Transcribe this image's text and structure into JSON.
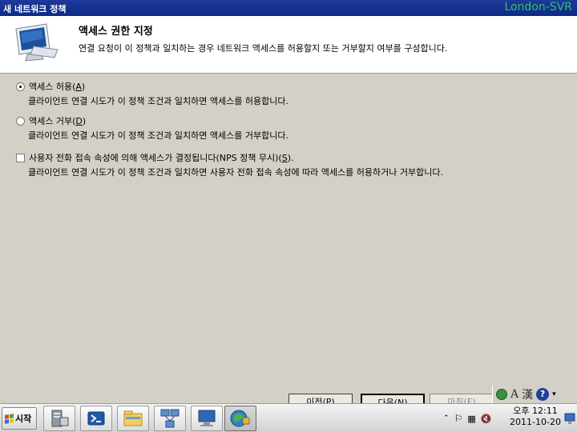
{
  "window": {
    "title": "새 네트워크 정책",
    "server_label": "London-SVR"
  },
  "header": {
    "title": "액세스 권한 지정",
    "description": "연결 요청이 이 정책과 일치하는 경우 네트워크 액세스를 허용할지 또는 거부할지 여부를 구성합니다."
  },
  "options": {
    "grant": {
      "label_before": "액세스 허용(",
      "hotkey": "A",
      "label_after": ")",
      "description": "클라이언트 연결 시도가 이 정책 조건과 일치하면 액세스를 허용합니다.",
      "selected": true
    },
    "deny": {
      "label_before": "액세스 거부(",
      "hotkey": "D",
      "label_after": ")",
      "description": "클라이언트 연결 시도가 이 정책 조건과 일치하면 액세스를 거부합니다.",
      "selected": false
    },
    "dialin": {
      "label_before": "사용자 전화 접속 속성에 의해 액세스가 결정됩니다(NPS 정책 무시)(",
      "hotkey": "S",
      "label_after": ").",
      "description": "클라이언트 연결 시도가 이 정책 조건과 일치하면 사용자 전화 접속 속성에 따라 액세스를 허용하거나 거부합니다.",
      "checked": false
    }
  },
  "buttons": {
    "previous": "이전(P)",
    "next": "다음(N)",
    "finish": "마침(F)"
  },
  "language_bar": {
    "mode": "A",
    "hanja": "漢",
    "help": "?"
  },
  "taskbar": {
    "start_label": "시작",
    "apps": [
      "server-manager-icon",
      "powershell-icon",
      "explorer-icon",
      "network-icon",
      "remote-desktop-icon",
      "nps-icon"
    ]
  },
  "tray": {
    "time": "오후 12:11",
    "date": "2011-10-20"
  },
  "colors": {
    "titlebar": "#0c2a86",
    "server_label": "#2ec16b",
    "dialog_bg": "#d4d0c8"
  }
}
